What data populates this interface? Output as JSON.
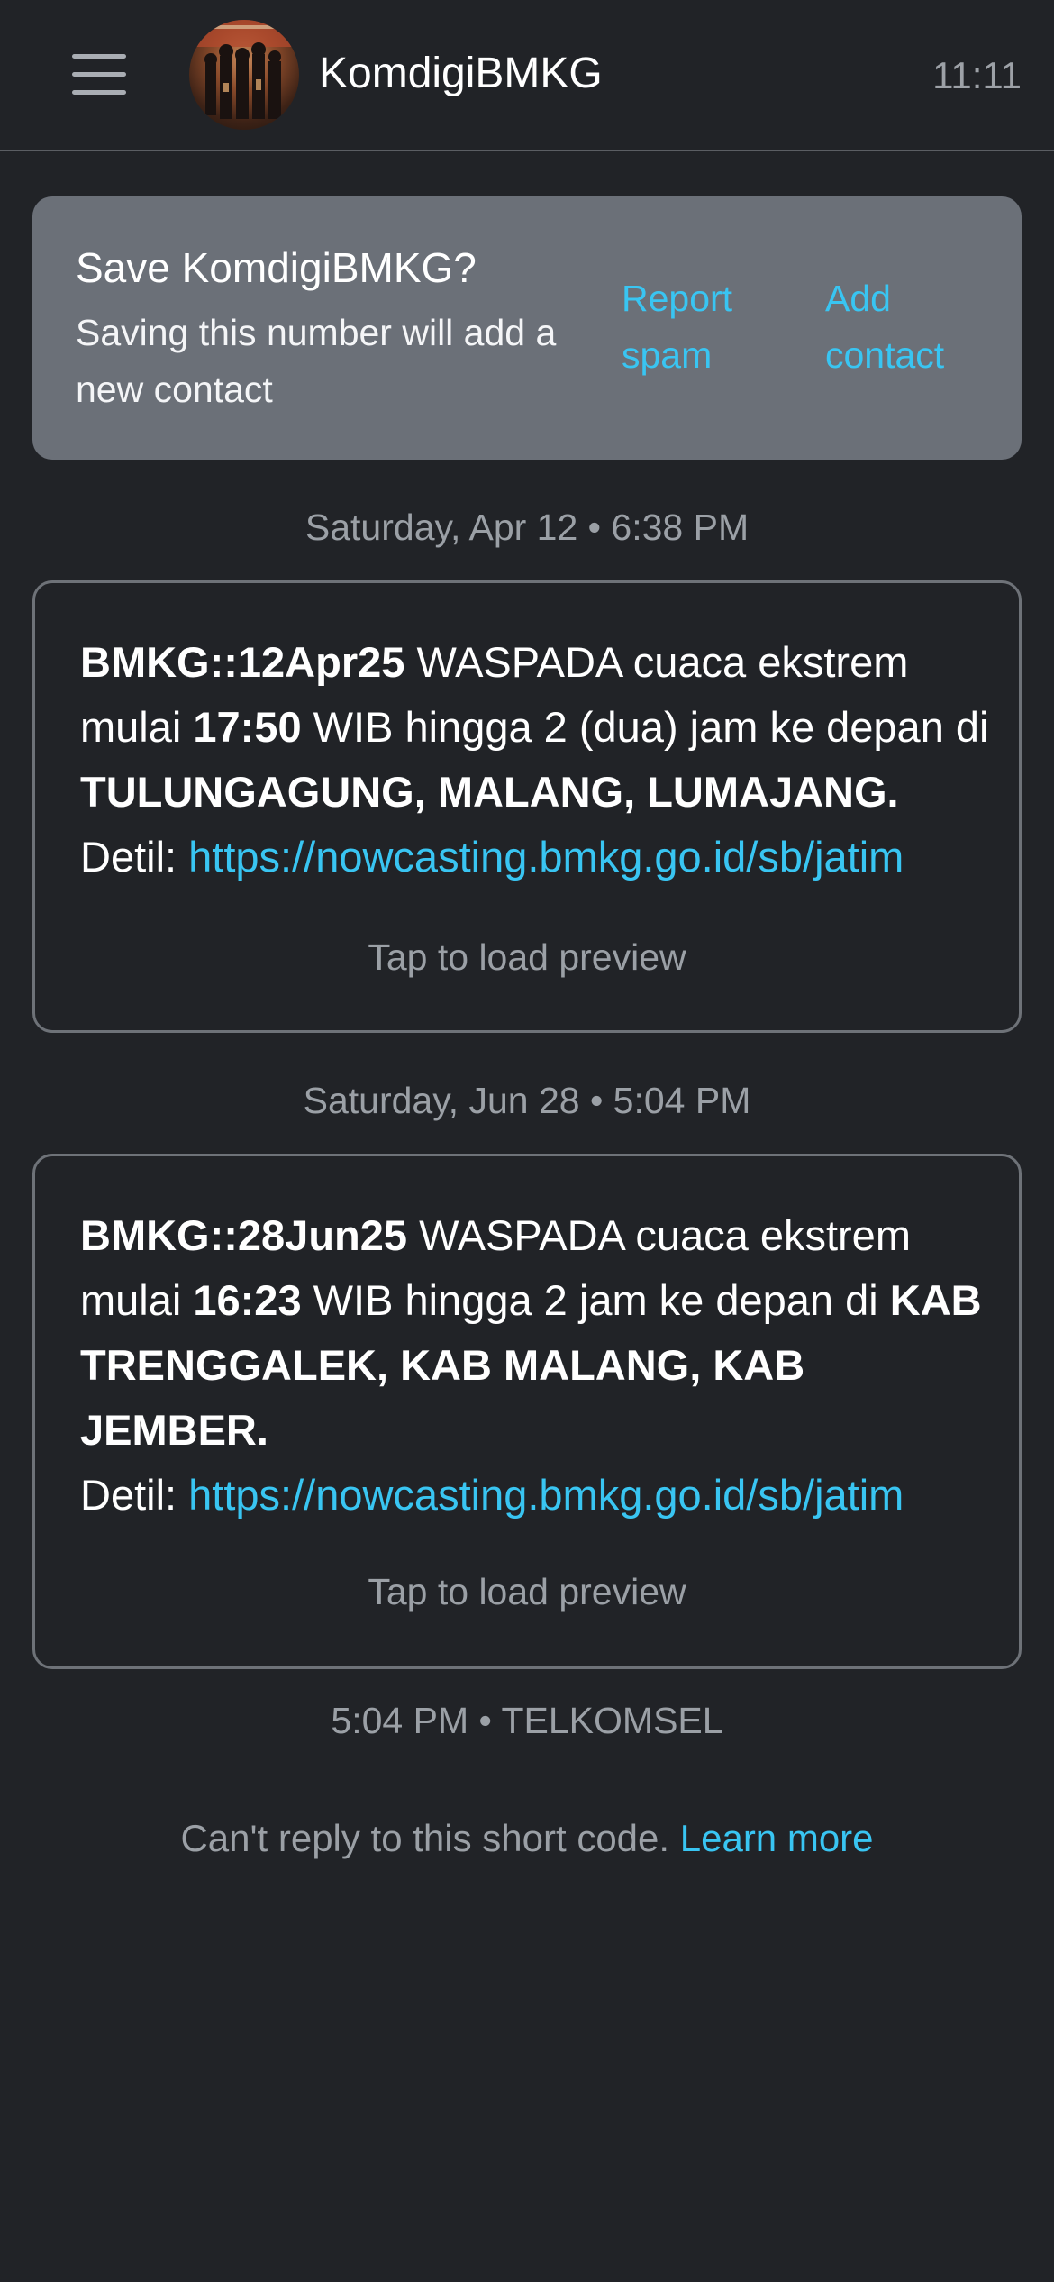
{
  "header": {
    "contact_name": "KomdigiBMKG",
    "time": "11:11"
  },
  "save_banner": {
    "title": "Save KomdigiBMKG?",
    "body": "Saving this number will add a new contact",
    "report_spam": "Report spam",
    "add_contact": "Add contact"
  },
  "messages": [
    {
      "date": "Saturday, Apr 12 • 6:38 PM",
      "parts": {
        "p1_bold": "BMKG::12Apr25",
        "p2": " WASPADA cuaca ekstrem mulai ",
        "p3_bold": "17:50",
        "p4": " WIB hingga 2 (dua) jam ke depan di ",
        "p5_bold": "TULUNGAGUNG, MALANG, LUMAJANG.",
        "p6": "Detil: ",
        "link": "https://nowcasting.bmkg.go.id/sb/jatim"
      },
      "preview": "Tap to load preview"
    },
    {
      "date": "Saturday, Jun 28 • 5:04 PM",
      "parts": {
        "p1_bold": "BMKG::28Jun25",
        "p2": " WASPADA cuaca ekstrem mulai ",
        "p3_bold": "16:23",
        "p4": " WIB hingga 2 jam ke depan di ",
        "p5_bold": "KAB TRENGGALEK, KAB MALANG, KAB JEMBER.",
        "p6": "Detil: ",
        "link": "https://nowcasting.bmkg.go.id/sb/jatim"
      },
      "preview": "Tap to load preview"
    }
  ],
  "last_meta": "5:04 PM • TELKOMSEL",
  "footer": {
    "text": "Can't reply to this short code. ",
    "learn_more": "Learn more"
  },
  "colors": {
    "background": "#212327",
    "banner": "#6b7078",
    "accent_link": "#39c5f2",
    "muted_text": "#9ba0a6"
  }
}
